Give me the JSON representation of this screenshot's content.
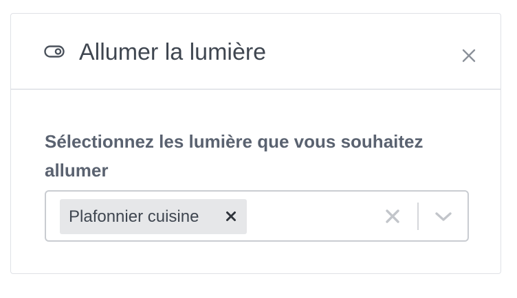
{
  "dialog": {
    "title": "Allumer la lumière",
    "header_icon": "toggle-icon",
    "close_icon": "close-icon"
  },
  "form": {
    "label": "Sélectionnez les lumière que vous souhaitez allumer",
    "select": {
      "selected": [
        {
          "label": "Plafonnier cuisine",
          "remove_icon": "close-icon"
        }
      ],
      "clear_icon": "clear-icon",
      "dropdown_icon": "chevron-down-icon"
    }
  },
  "colors": {
    "title_text": "#3f4650",
    "label_text": "#5a6270",
    "border": "#dfe1e6",
    "chip_bg": "#e6e7e9",
    "icon_muted": "#c2c5ca"
  }
}
